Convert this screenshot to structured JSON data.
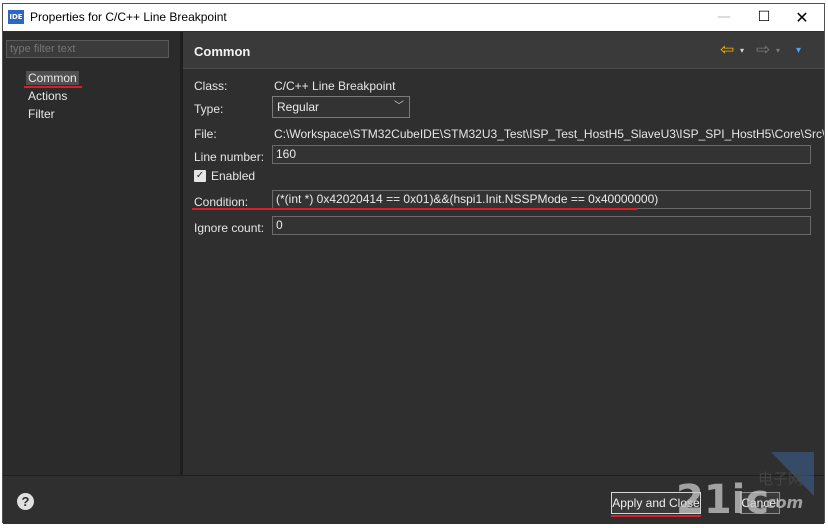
{
  "window": {
    "app_icon_text": "IDE",
    "title": "Properties for C/C++ Line Breakpoint",
    "min_symbol": "—",
    "max_symbol": "☐",
    "close_symbol": "✕"
  },
  "sidebar": {
    "filter_placeholder": "type filter text",
    "items": [
      {
        "label": "Common"
      },
      {
        "label": "Actions"
      },
      {
        "label": "Filter"
      }
    ]
  },
  "page": {
    "title": "Common",
    "back_arrow": "⇦",
    "forward_arrow": "⇨",
    "dropdown_glyph": "▾",
    "menu_glyph": "▾"
  },
  "form": {
    "class_label": "Class:",
    "class_value": "C/C++ Line Breakpoint",
    "type_label": "Type:",
    "type_value": "Regular",
    "file_label": "File:",
    "file_value": "C:\\Workspace\\STM32CubeIDE\\STM32U3_Test\\ISP_Test_HostH5_SlaveU3\\ISP_SPI_HostH5\\Core\\Src\\main.c",
    "line_label": "Line number:",
    "line_value": "160",
    "enabled_label": "Enabled",
    "enabled_checked": true,
    "condition_label": "Condition:",
    "condition_value": "(*(int *) 0x42020414 == 0x01)&&(hspi1.Init.NSSPMode == 0x40000000)",
    "ignore_label": "Ignore count:",
    "ignore_value": "0"
  },
  "footer": {
    "help_symbol": "?",
    "apply_label": "Apply and Close",
    "cancel_label": "Cancel"
  },
  "watermark": {
    "text": "21ic",
    "sub": "电子网",
    "domain": ".com"
  },
  "colors": {
    "annotation_red": "#d4202a",
    "nav_arrow_yellow": "#f0b400",
    "menu_blue": "#4aa3ff"
  }
}
